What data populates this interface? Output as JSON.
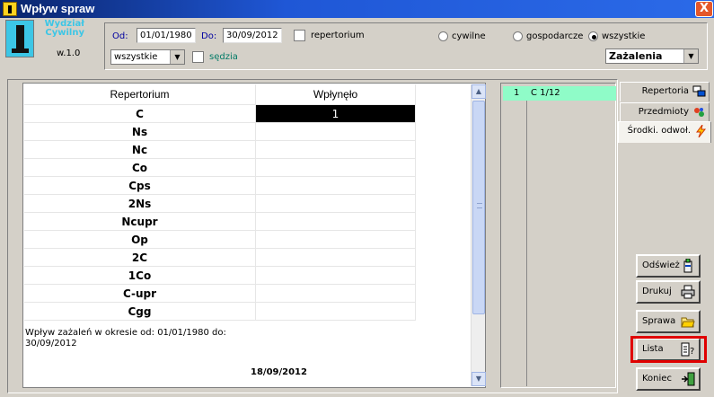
{
  "window": {
    "title": "Wpływ spraw",
    "close_label": "X"
  },
  "header": {
    "department": "Wydział Cywilny",
    "version": "w.1.0",
    "od_label": "Od:",
    "od_value": "01/01/1980",
    "do_label": "Do:",
    "do_value": "30/09/2012",
    "repertorium_label": "repertorium",
    "repertorium_checked": false,
    "sedzia_label": "sędzia",
    "sedzia_checked": false,
    "filter_select_value": "wszystkie",
    "radios": [
      {
        "label": "cywilne",
        "checked": false
      },
      {
        "label": "gospodarcze",
        "checked": false
      },
      {
        "label": "wszystkie",
        "checked": true
      }
    ],
    "type_select_value": "Zażalenia"
  },
  "grid": {
    "columns": [
      "Repertorium",
      "Wpłynęło"
    ],
    "rows": [
      {
        "rep": "C",
        "value": "1"
      },
      {
        "rep": "Ns",
        "value": ""
      },
      {
        "rep": "Nc",
        "value": ""
      },
      {
        "rep": "Co",
        "value": ""
      },
      {
        "rep": "Cps",
        "value": ""
      },
      {
        "rep": "2Ns",
        "value": ""
      },
      {
        "rep": "Ncupr",
        "value": ""
      },
      {
        "rep": "Op",
        "value": ""
      },
      {
        "rep": "2C",
        "value": ""
      },
      {
        "rep": "1Co",
        "value": ""
      },
      {
        "rep": "C-upr",
        "value": ""
      },
      {
        "rep": "Cgg",
        "value": ""
      }
    ],
    "summary": "Wpływ zażaleń  w okresie od: 01/01/1980 do: 30/09/2012",
    "report_date": "18/09/2012"
  },
  "list": {
    "items": [
      {
        "num": "1",
        "sig": "C  1/12"
      }
    ]
  },
  "tabs": [
    {
      "label": "Repertoria",
      "icon": "repertoria-icon",
      "active": false
    },
    {
      "label": "Przedmioty",
      "icon": "przedmioty-icon",
      "active": false
    },
    {
      "label": "Środki. odwoł.",
      "icon": "srodki-icon",
      "active": true
    }
  ],
  "buttons": {
    "odswiez": "Odśwież",
    "drukuj": "Drukuj",
    "sprawa": "Sprawa",
    "lista": "Lista",
    "koniec": "Koniec"
  },
  "colors": {
    "accent": "#3cc6e6",
    "list_highlight": "#8ffcc8",
    "focus_frame": "#e00000"
  }
}
